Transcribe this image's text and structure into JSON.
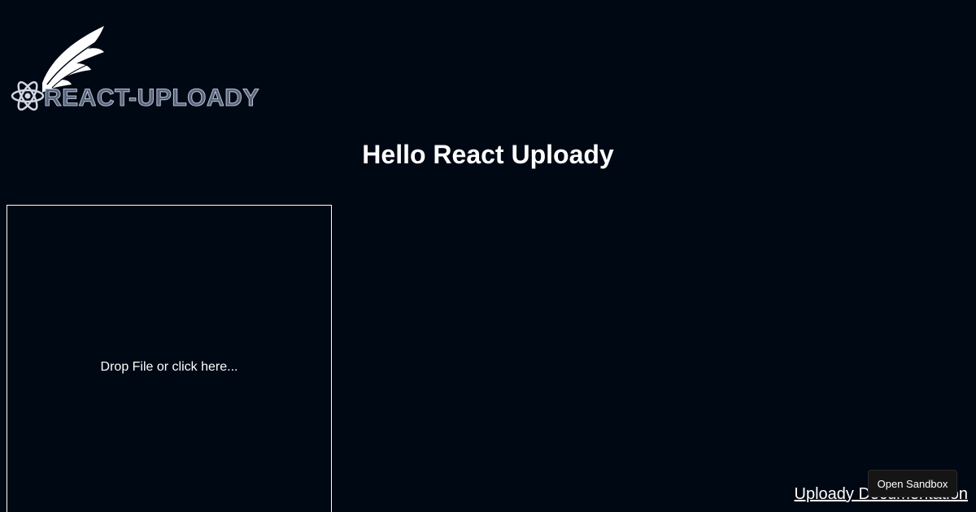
{
  "logo": {
    "text": "REACT-UPLOADY",
    "icon": "react-wing-logo-icon"
  },
  "heading": "Hello React Uploady",
  "dropzone": {
    "label": "Drop File or click here..."
  },
  "links": {
    "docs": "Uploady Documentation"
  },
  "sandbox": {
    "label": "Open Sandbox"
  }
}
